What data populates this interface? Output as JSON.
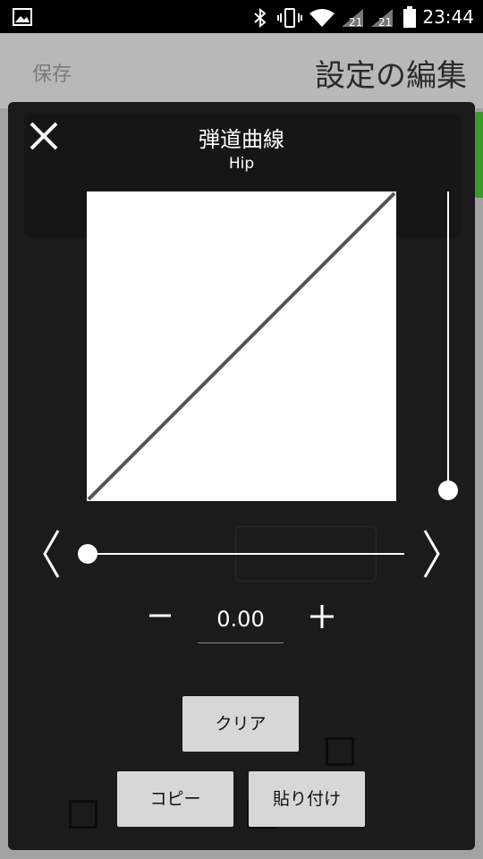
{
  "statusbar": {
    "time": "23:44",
    "icons": [
      "gallery-icon",
      "bluetooth-icon",
      "vibrate-icon",
      "wifi-icon",
      "signal-icon",
      "signal-icon",
      "battery-icon"
    ]
  },
  "background": {
    "save_label": "保存",
    "title": "設定の編集"
  },
  "dialog": {
    "title": "弾道曲線",
    "subtitle": "Hip",
    "value": "0.00",
    "clear_label": "クリア",
    "copy_label": "コピー",
    "paste_label": "貼り付け",
    "close_icon": "close-icon",
    "prev_icon": "chevron-left-icon",
    "next_icon": "chevron-right-icon",
    "minus_icon": "minus-icon",
    "plus_icon": "plus-icon"
  },
  "colors": {
    "dialog_bg": "#1b1b1b",
    "button_bg": "#d7d7d7",
    "curve": "#555555"
  }
}
